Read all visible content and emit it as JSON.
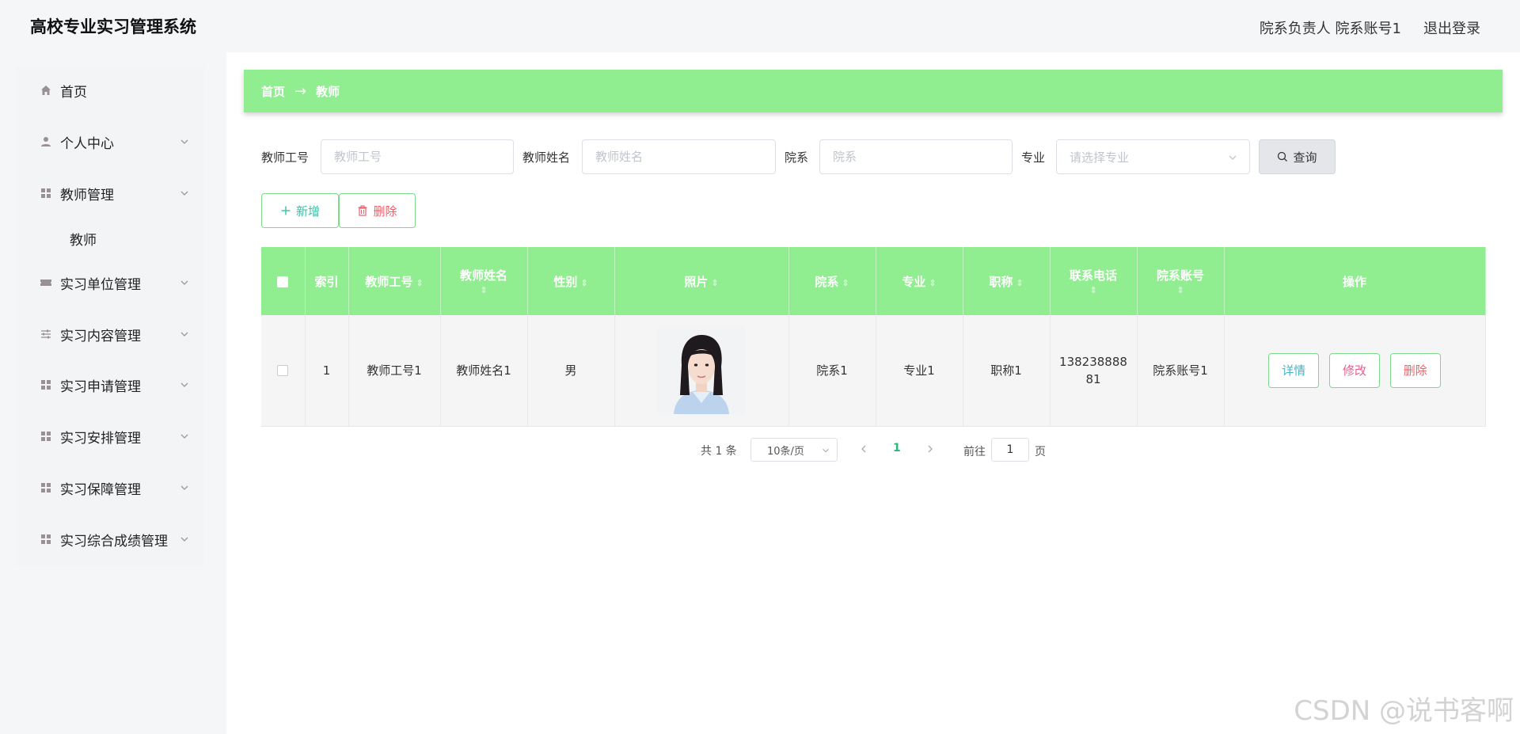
{
  "header": {
    "app_title": "高校专业实习管理系统",
    "user_info": "院系负责人 院系账号1",
    "logout_label": "退出登录"
  },
  "sidebar": {
    "items": [
      {
        "label": "首页",
        "icon": "home-icon",
        "has_children": false
      },
      {
        "label": "个人中心",
        "icon": "person-icon",
        "has_children": true
      },
      {
        "label": "教师管理",
        "icon": "grid-icon",
        "has_children": true
      },
      {
        "label": "实习单位管理",
        "icon": "ticket-icon",
        "has_children": true
      },
      {
        "label": "实习内容管理",
        "icon": "sliders-icon",
        "has_children": true
      },
      {
        "label": "实习申请管理",
        "icon": "grid-icon",
        "has_children": true
      },
      {
        "label": "实习安排管理",
        "icon": "grid-icon",
        "has_children": true
      },
      {
        "label": "实习保障管理",
        "icon": "grid-icon",
        "has_children": true
      },
      {
        "label": "实习综合成绩管理",
        "icon": "grid-icon",
        "has_children": true
      }
    ],
    "submenu_teacher": "教师"
  },
  "breadcrumb": {
    "home": "首页",
    "arrow": "→",
    "current": "教师"
  },
  "search": {
    "teacher_id_label": "教师工号",
    "teacher_id_placeholder": "教师工号",
    "teacher_name_label": "教师姓名",
    "teacher_name_placeholder": "教师姓名",
    "department_label": "院系",
    "department_placeholder": "院系",
    "major_label": "专业",
    "major_placeholder": "请选择专业",
    "query_label": "查询"
  },
  "actions": {
    "add_label": "新增",
    "delete_label": "删除"
  },
  "table": {
    "headers": {
      "index": "索引",
      "teacher_id": "教师工号",
      "teacher_name": "教师姓名",
      "gender": "性别",
      "photo": "照片",
      "department": "院系",
      "major": "专业",
      "title": "职称",
      "phone": "联系电话",
      "dept_account": "院系账号",
      "operation": "操作"
    },
    "rows": [
      {
        "index": "1",
        "teacher_id": "教师工号1",
        "teacher_name": "教师姓名1",
        "gender": "男",
        "department": "院系1",
        "major": "专业1",
        "title": "职称1",
        "phone_line1": "138238888",
        "phone_line2": "81",
        "dept_account": "院系账号1",
        "detail_label": "详情",
        "edit_label": "修改",
        "delete_label": "删除"
      }
    ]
  },
  "pagination": {
    "total": "共 1 条",
    "page_size": "10条/页",
    "current_page": "1",
    "goto_prefix": "前往",
    "goto_value": "1",
    "goto_suffix": "页"
  },
  "watermark": "CSDN @说书客啊",
  "colors": {
    "accent_green": "#90ee90",
    "detail_text": "#3fb6c7",
    "edit_text": "#e65f8e",
    "delete_text": "#e8626b",
    "add_text": "#3dbfa6",
    "active_page": "#2fb67c"
  }
}
